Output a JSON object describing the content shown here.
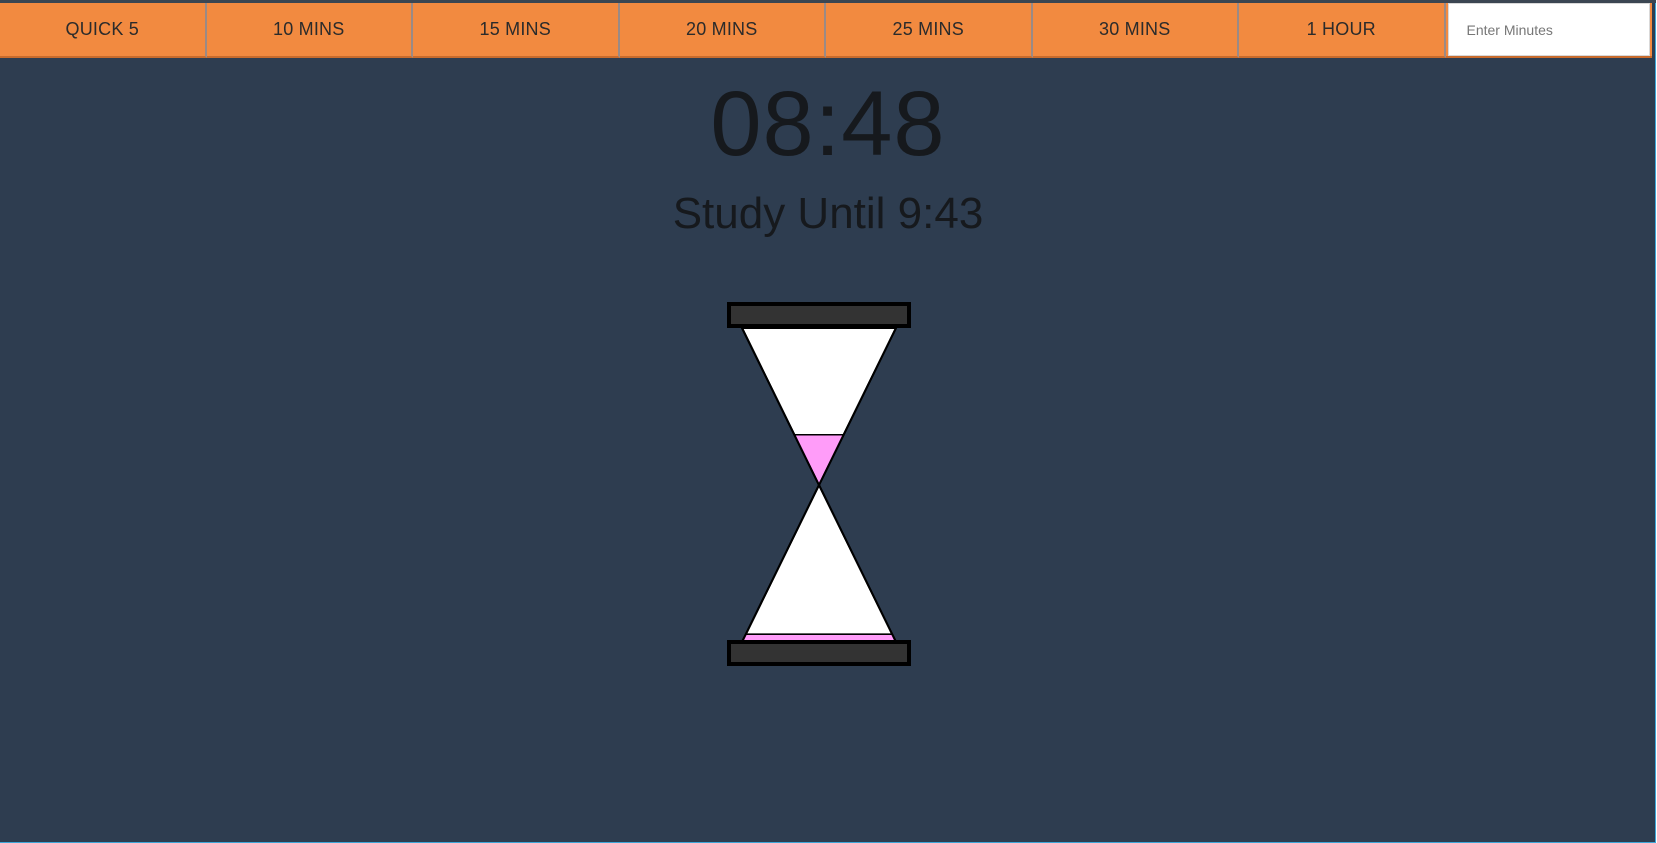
{
  "presets": [
    {
      "label": "QUICK 5"
    },
    {
      "label": "10 MINS"
    },
    {
      "label": "15 MINS"
    },
    {
      "label": "20 MINS"
    },
    {
      "label": "25 MINS"
    },
    {
      "label": "30 MINS"
    },
    {
      "label": "1 HOUR"
    }
  ],
  "custom_minutes": {
    "placeholder": "Enter Minutes",
    "value": ""
  },
  "timer": {
    "remaining": "08:48",
    "until_text": "Study Until 9:43"
  },
  "hourglass": {
    "sand_color": "#ff9cf9",
    "glass_color": "#ffffff",
    "cap_color": "#333333",
    "top_sand_fraction": 0.32,
    "bottom_sand_fraction": 0.05
  },
  "colors": {
    "background": "#2e3d50",
    "toolbar": "#f28a40",
    "text": "#16191d"
  }
}
